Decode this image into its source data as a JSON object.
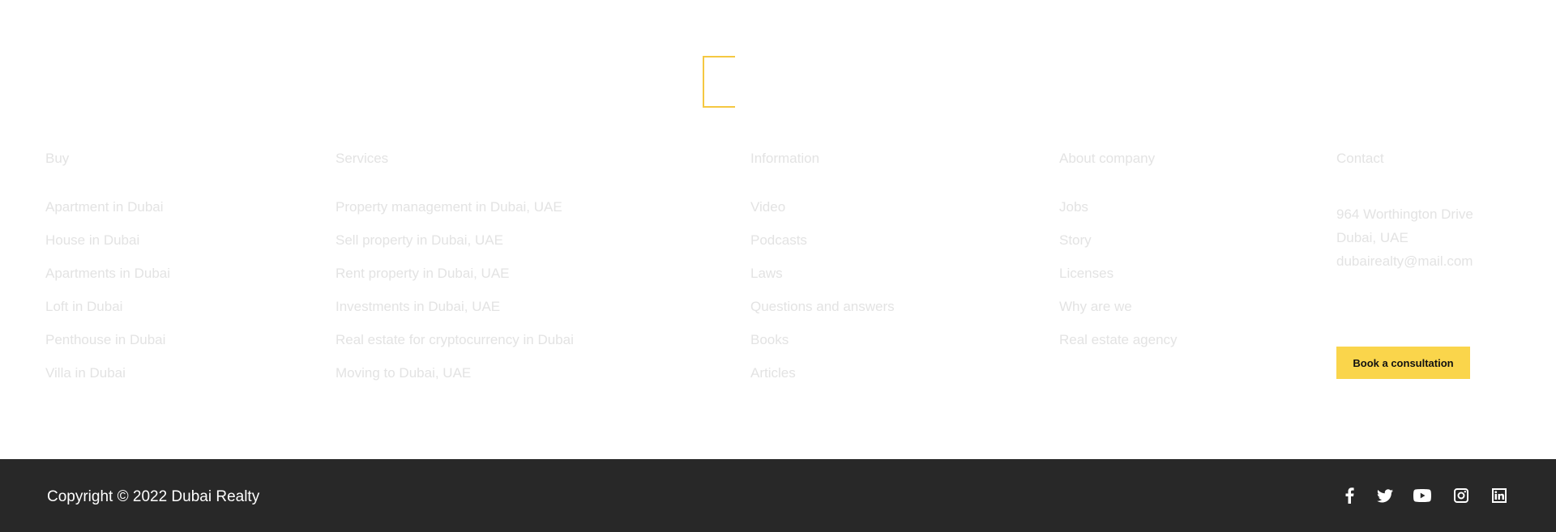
{
  "columns": {
    "buy": {
      "heading": "Buy",
      "items": [
        "Apartment in Dubai",
        "House in Dubai",
        "Apartments in Dubai",
        "Loft in Dubai",
        "Penthouse in Dubai",
        "Villa in Dubai"
      ]
    },
    "services": {
      "heading": "Services",
      "items": [
        "Property management in Dubai, UAE",
        "Sell property in Dubai, UAE",
        "Rent property in Dubai, UAE",
        "Investments in Dubai, UAE",
        "Real estate for cryptocurrency in Dubai",
        "Moving to Dubai, UAE"
      ]
    },
    "information": {
      "heading": "Information",
      "items": [
        "Video",
        "Podcasts",
        "Laws",
        "Questions and answers",
        "Books",
        "Articles"
      ]
    },
    "about": {
      "heading": "About company",
      "items": [
        "Jobs",
        "Story",
        "Licenses",
        "Why are we",
        "Real estate agency"
      ]
    },
    "contact": {
      "heading": "Contact",
      "address_line1": "964 Worthington Drive",
      "address_line2": "Dubai, UAE",
      "email": "dubairealty@mail.com"
    }
  },
  "cta": {
    "label": "Book a consultation"
  },
  "footer": {
    "copyright": "Copyright © 2022 Dubai Realty",
    "social_icons": [
      "facebook-icon",
      "twitter-icon",
      "youtube-icon",
      "instagram-icon",
      "linkedin-icon"
    ]
  },
  "colors": {
    "accent": "#fad54b",
    "footer_bg": "#282828",
    "muted_text": "#e3e3e3"
  }
}
